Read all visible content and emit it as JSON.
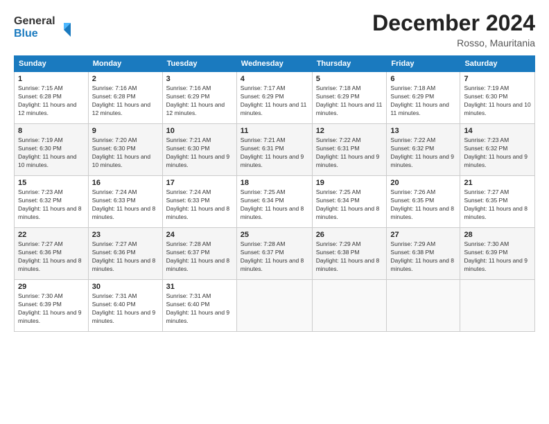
{
  "header": {
    "logo_general": "General",
    "logo_blue": "Blue",
    "month_title": "December 2024",
    "location": "Rosso, Mauritania"
  },
  "weekdays": [
    "Sunday",
    "Monday",
    "Tuesday",
    "Wednesday",
    "Thursday",
    "Friday",
    "Saturday"
  ],
  "weeks": [
    [
      {
        "day": "1",
        "sunrise": "7:15 AM",
        "sunset": "6:28 PM",
        "daylight": "11 hours and 12 minutes."
      },
      {
        "day": "2",
        "sunrise": "7:16 AM",
        "sunset": "6:28 PM",
        "daylight": "11 hours and 12 minutes."
      },
      {
        "day": "3",
        "sunrise": "7:16 AM",
        "sunset": "6:29 PM",
        "daylight": "11 hours and 12 minutes."
      },
      {
        "day": "4",
        "sunrise": "7:17 AM",
        "sunset": "6:29 PM",
        "daylight": "11 hours and 11 minutes."
      },
      {
        "day": "5",
        "sunrise": "7:18 AM",
        "sunset": "6:29 PM",
        "daylight": "11 hours and 11 minutes."
      },
      {
        "day": "6",
        "sunrise": "7:18 AM",
        "sunset": "6:29 PM",
        "daylight": "11 hours and 11 minutes."
      },
      {
        "day": "7",
        "sunrise": "7:19 AM",
        "sunset": "6:30 PM",
        "daylight": "11 hours and 10 minutes."
      }
    ],
    [
      {
        "day": "8",
        "sunrise": "7:19 AM",
        "sunset": "6:30 PM",
        "daylight": "11 hours and 10 minutes."
      },
      {
        "day": "9",
        "sunrise": "7:20 AM",
        "sunset": "6:30 PM",
        "daylight": "11 hours and 10 minutes."
      },
      {
        "day": "10",
        "sunrise": "7:21 AM",
        "sunset": "6:30 PM",
        "daylight": "11 hours and 9 minutes."
      },
      {
        "day": "11",
        "sunrise": "7:21 AM",
        "sunset": "6:31 PM",
        "daylight": "11 hours and 9 minutes."
      },
      {
        "day": "12",
        "sunrise": "7:22 AM",
        "sunset": "6:31 PM",
        "daylight": "11 hours and 9 minutes."
      },
      {
        "day": "13",
        "sunrise": "7:22 AM",
        "sunset": "6:32 PM",
        "daylight": "11 hours and 9 minutes."
      },
      {
        "day": "14",
        "sunrise": "7:23 AM",
        "sunset": "6:32 PM",
        "daylight": "11 hours and 9 minutes."
      }
    ],
    [
      {
        "day": "15",
        "sunrise": "7:23 AM",
        "sunset": "6:32 PM",
        "daylight": "11 hours and 8 minutes."
      },
      {
        "day": "16",
        "sunrise": "7:24 AM",
        "sunset": "6:33 PM",
        "daylight": "11 hours and 8 minutes."
      },
      {
        "day": "17",
        "sunrise": "7:24 AM",
        "sunset": "6:33 PM",
        "daylight": "11 hours and 8 minutes."
      },
      {
        "day": "18",
        "sunrise": "7:25 AM",
        "sunset": "6:34 PM",
        "daylight": "11 hours and 8 minutes."
      },
      {
        "day": "19",
        "sunrise": "7:25 AM",
        "sunset": "6:34 PM",
        "daylight": "11 hours and 8 minutes."
      },
      {
        "day": "20",
        "sunrise": "7:26 AM",
        "sunset": "6:35 PM",
        "daylight": "11 hours and 8 minutes."
      },
      {
        "day": "21",
        "sunrise": "7:27 AM",
        "sunset": "6:35 PM",
        "daylight": "11 hours and 8 minutes."
      }
    ],
    [
      {
        "day": "22",
        "sunrise": "7:27 AM",
        "sunset": "6:36 PM",
        "daylight": "11 hours and 8 minutes."
      },
      {
        "day": "23",
        "sunrise": "7:27 AM",
        "sunset": "6:36 PM",
        "daylight": "11 hours and 8 minutes."
      },
      {
        "day": "24",
        "sunrise": "7:28 AM",
        "sunset": "6:37 PM",
        "daylight": "11 hours and 8 minutes."
      },
      {
        "day": "25",
        "sunrise": "7:28 AM",
        "sunset": "6:37 PM",
        "daylight": "11 hours and 8 minutes."
      },
      {
        "day": "26",
        "sunrise": "7:29 AM",
        "sunset": "6:38 PM",
        "daylight": "11 hours and 8 minutes."
      },
      {
        "day": "27",
        "sunrise": "7:29 AM",
        "sunset": "6:38 PM",
        "daylight": "11 hours and 8 minutes."
      },
      {
        "day": "28",
        "sunrise": "7:30 AM",
        "sunset": "6:39 PM",
        "daylight": "11 hours and 9 minutes."
      }
    ],
    [
      {
        "day": "29",
        "sunrise": "7:30 AM",
        "sunset": "6:39 PM",
        "daylight": "11 hours and 9 minutes."
      },
      {
        "day": "30",
        "sunrise": "7:31 AM",
        "sunset": "6:40 PM",
        "daylight": "11 hours and 9 minutes."
      },
      {
        "day": "31",
        "sunrise": "7:31 AM",
        "sunset": "6:40 PM",
        "daylight": "11 hours and 9 minutes."
      },
      null,
      null,
      null,
      null
    ]
  ],
  "labels": {
    "sunrise": "Sunrise: ",
    "sunset": "Sunset: ",
    "daylight": "Daylight: "
  }
}
